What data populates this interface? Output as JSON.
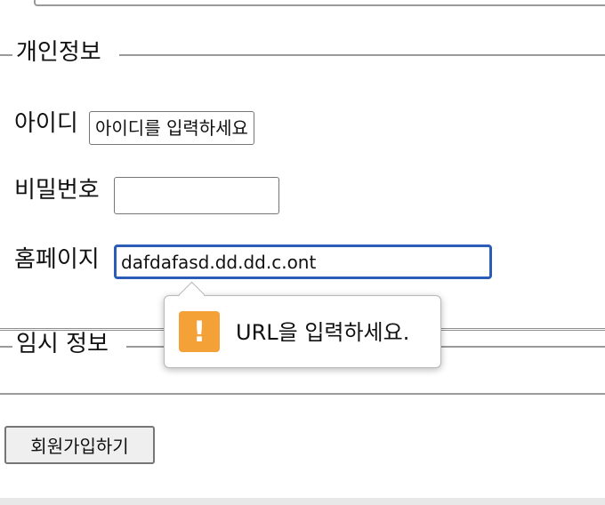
{
  "personal_info": {
    "legend": "개인정보",
    "id_label": "아이디",
    "id_placeholder": "아이디를 입력하세요",
    "password_label": "비밀번호",
    "password_value": "",
    "homepage_label": "홈페이지",
    "homepage_value": "dafdafasd.dd.dd.c.ont"
  },
  "validation_tooltip": {
    "message": "URL을 입력하세요.",
    "icon": "exclamation-warning-icon",
    "icon_glyph": "!",
    "icon_color": "#f4a237"
  },
  "temp_info": {
    "legend": "임시 정보"
  },
  "submit_button": {
    "label": "회원가입하기"
  },
  "colors": {
    "focus_border": "#2b5cb8",
    "fieldset_border": "#9a9a9a"
  }
}
